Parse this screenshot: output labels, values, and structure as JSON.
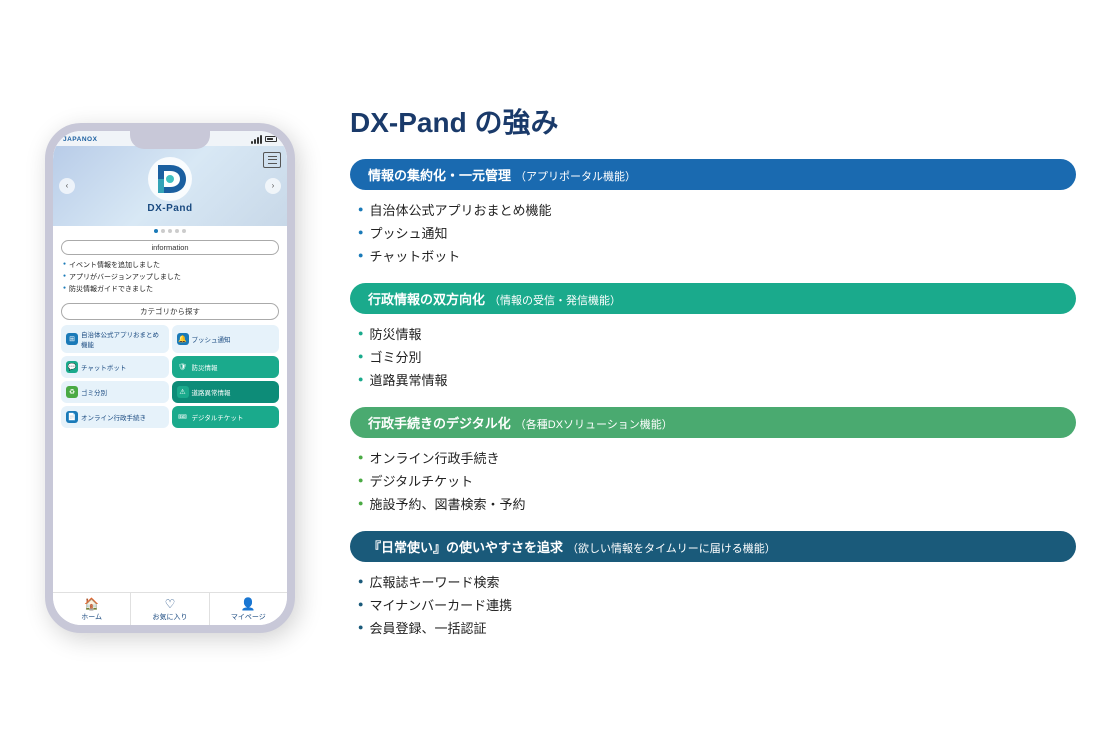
{
  "page": {
    "title": "DX-Pand の強み"
  },
  "phone": {
    "brand": "JAPANOX",
    "app_name": "DX-Pand",
    "info_box_label": "information",
    "info_items": [
      "イベント情報を追加しました",
      "アプリがバージョンアップしました",
      "防災情報ガイドできました"
    ],
    "category_title": "カテゴリから探す",
    "categories": [
      {
        "label": "自治体公式アプリおまとめ機能",
        "color": "blue"
      },
      {
        "label": "プッシュ通知",
        "color": "blue"
      },
      {
        "label": "チャットボット",
        "color": "teal"
      },
      {
        "label": "防災情報",
        "color": "teal"
      },
      {
        "label": "ゴミ分別",
        "color": "green"
      },
      {
        "label": "道路異常情報",
        "color": "teal"
      },
      {
        "label": "オンライン行政手続き",
        "color": "blue"
      },
      {
        "label": "デジタルチケット",
        "color": "teal"
      }
    ],
    "nav_items": [
      {
        "icon": "🏠",
        "label": "ホーム"
      },
      {
        "icon": "♡",
        "label": "お気に入り"
      },
      {
        "icon": "👤",
        "label": "マイページ"
      }
    ]
  },
  "features": [
    {
      "id": "feature1",
      "header": "情報の集約化・一元管理",
      "subheader": "（アプリポータル機能）",
      "color_class": "fh-blue",
      "list_class": "",
      "items": [
        "自治体公式アプリおまとめ機能",
        "プッシュ通知",
        "チャットボット"
      ]
    },
    {
      "id": "feature2",
      "header": "行政情報の双方向化",
      "subheader": "（情報の受信・発信機能）",
      "color_class": "fh-teal",
      "list_class": "teal",
      "items": [
        "防災情報",
        "ゴミ分別",
        "道路異常情報"
      ]
    },
    {
      "id": "feature3",
      "header": "行政手続きのデジタル化",
      "subheader": "（各種DXソリューション機能）",
      "color_class": "fh-green",
      "list_class": "green",
      "items": [
        "オンライン行政手続き",
        "デジタルチケット",
        "施設予約、図書検索・予約"
      ]
    },
    {
      "id": "feature4",
      "header": "『日常使い』の使いやすさを追求",
      "subheader": "（欲しい情報をタイムリーに届ける機能）",
      "color_class": "fh-dark",
      "list_class": "dark",
      "items": [
        "広報誌キーワード検索",
        "マイナンバーカード連携",
        "会員登録、一括認証"
      ]
    }
  ]
}
